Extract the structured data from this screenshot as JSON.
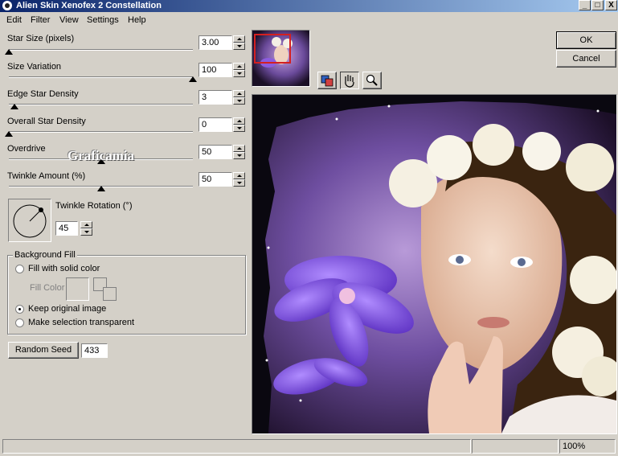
{
  "window": {
    "title": "Alien Skin Xenofex 2 Constellation",
    "minimize": "_",
    "maximize": "□",
    "close": "X"
  },
  "menu": [
    "Edit",
    "Filter",
    "View",
    "Settings",
    "Help"
  ],
  "sliders": [
    {
      "label": "Star Size (pixels)",
      "value": "3.00",
      "level": 0.0
    },
    {
      "label": "Size Variation",
      "value": "100",
      "level": 1.0
    },
    {
      "label": "Edge Star Density",
      "value": "3",
      "level": 0.03
    },
    {
      "label": "Overall Star Density",
      "value": "0",
      "level": 0.0
    },
    {
      "label": "Overdrive",
      "value": "50",
      "level": 0.5
    },
    {
      "label": "Twinkle Amount (%)",
      "value": "50",
      "level": 0.5
    }
  ],
  "watermark": "Graficamia",
  "twinkle_rotation": {
    "label": "Twinkle Rotation (°)",
    "value": "45"
  },
  "background_fill": {
    "title": "Background Fill",
    "options": [
      "Fill with solid color",
      "Keep original image",
      "Make selection transparent"
    ],
    "selected": "Keep original image",
    "fill_color_label": "Fill Color"
  },
  "random_seed": {
    "label": "Random Seed",
    "value": "433"
  },
  "buttons": {
    "ok": "OK",
    "cancel": "Cancel"
  },
  "tools": [
    "preview-toggle-icon",
    "hand-pan-icon",
    "zoom-magnifier-icon"
  ],
  "status": {
    "zoom": "100%"
  }
}
